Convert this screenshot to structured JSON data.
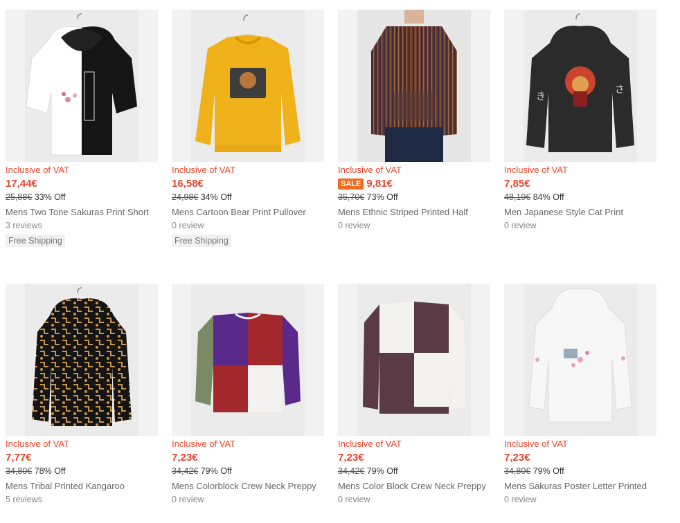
{
  "products": [
    {
      "vat": "Inclusive of VAT",
      "price": "17,44€",
      "sale": "",
      "old_price": "25,88€",
      "discount": "33% Off",
      "title": "Mens Two Tone Sakuras Print Short",
      "reviews": "3 reviews",
      "shipping": "Free Shipping",
      "image": "two-tone-sakura-hoodie-image"
    },
    {
      "vat": "Inclusive of VAT",
      "price": "16,58€",
      "sale": "",
      "old_price": "24,98€",
      "discount": "34% Off",
      "title": "Mens Cartoon Bear Print Pullover",
      "reviews": "0 review",
      "shipping": "Free Shipping",
      "image": "cartoon-bear-sweatshirt-image"
    },
    {
      "vat": "Inclusive of VAT",
      "price": "9,81€",
      "sale": "SALE",
      "old_price": "35,70€",
      "discount": "73% Off",
      "title": "Mens Ethnic Striped Printed Half",
      "reviews": "0 review",
      "shipping": "",
      "image": "ethnic-striped-hoodie-image"
    },
    {
      "vat": "Inclusive of VAT",
      "price": "7,85€",
      "sale": "",
      "old_price": "48,19€",
      "discount": "84% Off",
      "title": "Men Japanese Style Cat Print",
      "reviews": "0 review",
      "shipping": "",
      "image": "japanese-cat-hoodie-image"
    },
    {
      "vat": "Inclusive of VAT",
      "price": "7,77€",
      "sale": "",
      "old_price": "34,80€",
      "discount": "78% Off",
      "title": "Mens Tribal Printed Kangaroo",
      "reviews": "5 reviews",
      "shipping": "",
      "image": "tribal-hoodie-image"
    },
    {
      "vat": "Inclusive of VAT",
      "price": "7,23€",
      "sale": "",
      "old_price": "34,42€",
      "discount": "79% Off",
      "title": "Mens Colorblock Crew Neck Preppy",
      "reviews": "0 review",
      "shipping": "",
      "image": "colorblock-sweatshirt-image"
    },
    {
      "vat": "Inclusive of VAT",
      "price": "7,23€",
      "sale": "",
      "old_price": "34,42€",
      "discount": "79% Off",
      "title": "Mens Color Block Crew Neck Preppy",
      "reviews": "0 review",
      "shipping": "",
      "image": "color-block-sweatshirt-image"
    },
    {
      "vat": "Inclusive of VAT",
      "price": "7,23€",
      "sale": "",
      "old_price": "34,80€",
      "discount": "79% Off",
      "title": "Mens Sakuras Poster Letter Printed",
      "reviews": "0 review",
      "shipping": "",
      "image": "sakura-poster-hoodie-image"
    }
  ],
  "colors": {
    "price": "#e8442c",
    "sale_badge": "#f26b21"
  }
}
